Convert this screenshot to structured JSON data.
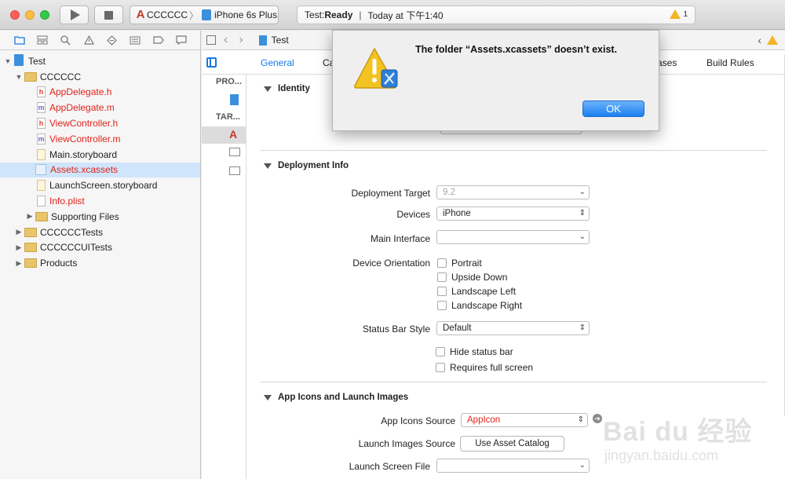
{
  "toolbar": {
    "scheme_name": "CCCCCC",
    "device_name": "iPhone 6s Plus",
    "status_prefix": "Test: ",
    "status_state": "Ready",
    "status_time": "Today at 下午1:40",
    "warning_count": "1"
  },
  "navigator": {
    "project": "Test",
    "items": [
      {
        "label": "CCCCCC",
        "kind": "folder"
      },
      {
        "label": "AppDelegate.h",
        "kind": "h"
      },
      {
        "label": "AppDelegate.m",
        "kind": "m"
      },
      {
        "label": "ViewController.h",
        "kind": "h"
      },
      {
        "label": "ViewController.m",
        "kind": "m"
      },
      {
        "label": "Main.storyboard",
        "kind": "storyboard"
      },
      {
        "label": "Assets.xcassets",
        "kind": "xcassets"
      },
      {
        "label": "LaunchScreen.storyboard",
        "kind": "storyboard"
      },
      {
        "label": "Info.plist",
        "kind": "plist"
      },
      {
        "label": "Supporting Files",
        "kind": "folder"
      },
      {
        "label": "CCCCCCTests",
        "kind": "folder"
      },
      {
        "label": "CCCCCCUITests",
        "kind": "folder"
      },
      {
        "label": "Products",
        "kind": "folder"
      }
    ]
  },
  "editor": {
    "breadcrumb": "Test",
    "tabs": [
      "General",
      "Ca",
      "ases",
      "Build Rules"
    ],
    "targets": {
      "project_header": "PRO...",
      "targets_header": "TAR..."
    },
    "identity": {
      "title": "Identity"
    },
    "deployment": {
      "title": "Deployment Info",
      "target_label": "Deployment Target",
      "target_value": "9.2",
      "devices_label": "Devices",
      "devices_value": "iPhone",
      "main_interface_label": "Main Interface",
      "main_interface_value": "",
      "orientation_label": "Device Orientation",
      "orientations": [
        "Portrait",
        "Upside Down",
        "Landscape Left",
        "Landscape Right"
      ],
      "status_bar_label": "Status Bar Style",
      "status_bar_value": "Default",
      "hide_status_bar": "Hide status bar",
      "requires_full_screen": "Requires full screen"
    },
    "icons": {
      "title": "App Icons and Launch Images",
      "app_icons_label": "App Icons Source",
      "app_icons_value": "AppIcon",
      "launch_images_label": "Launch Images Source",
      "launch_images_button": "Use Asset Catalog",
      "launch_screen_label": "Launch Screen File",
      "launch_screen_value": ""
    }
  },
  "alert": {
    "message": "The folder “Assets.xcassets” doesn’t exist.",
    "ok_label": "OK"
  },
  "watermark": {
    "logo": "Bai du 经验",
    "url": "jingyan.baidu.com"
  },
  "colors": {
    "accent": "#1a78e0",
    "missing_file": "#e0241b",
    "warning": "#f2b526"
  }
}
